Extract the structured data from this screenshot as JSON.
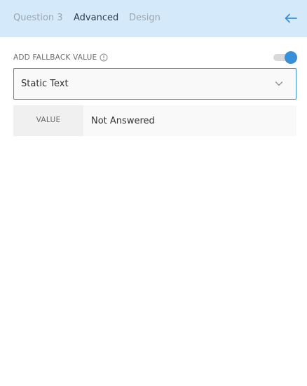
{
  "header": {
    "tabs": [
      {
        "label": "Question 3"
      },
      {
        "label": "Advanced"
      },
      {
        "label": "Design"
      }
    ],
    "active_tab": "Advanced"
  },
  "fallback": {
    "label": "ADD FALLBACK VALUE",
    "toggle_on": true,
    "type_select": {
      "value": "Static Text"
    },
    "value_field": {
      "label": "VALUE",
      "value": "Not Answered"
    }
  },
  "colors": {
    "header_bg": "#d4e9f9",
    "accent": "#3a8fd9",
    "active_tab_text": "#2c3e50",
    "inactive_tab_text": "#9aa6b0"
  }
}
